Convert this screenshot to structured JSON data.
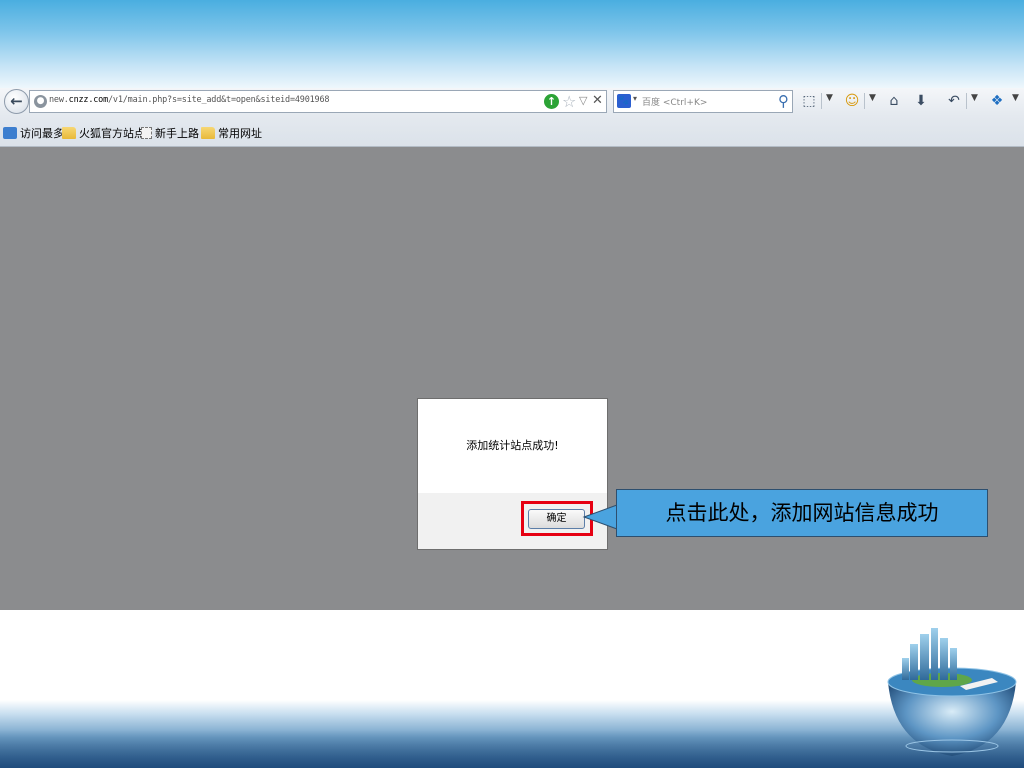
{
  "browser": {
    "url": {
      "prefix": "new.",
      "domain": "cnzz.com",
      "path": "/v1/main.php?s=site_add&t=open&siteid=4901968"
    },
    "search_placeholder": "百度 <Ctrl+K>",
    "icons": [
      "back-arrow-icon",
      "site-identity-icon",
      "go-icon",
      "bookmark-star-icon",
      "dropdown-icon",
      "stop-icon",
      "baidu-icon",
      "search-icon",
      "screenshot-icon",
      "smiley-icon",
      "home-icon",
      "save-icon",
      "history-icon",
      "addons-icon"
    ]
  },
  "bookmarks": [
    {
      "label": "访问最多",
      "icon": "search-icon"
    },
    {
      "label": "火狐官方站点",
      "icon": "folder-icon"
    },
    {
      "label": "新手上路",
      "icon": "page-icon"
    },
    {
      "label": "常用网址",
      "icon": "folder-icon"
    }
  ],
  "dialog": {
    "message": "添加统计站点成功!",
    "ok_label": "确定"
  },
  "callout": {
    "text": "点击此处，添加网站信息成功"
  },
  "colors": {
    "callout_bg": "#4aa3df",
    "highlight_border": "#e60012",
    "overlay": "#8b8c8e"
  }
}
